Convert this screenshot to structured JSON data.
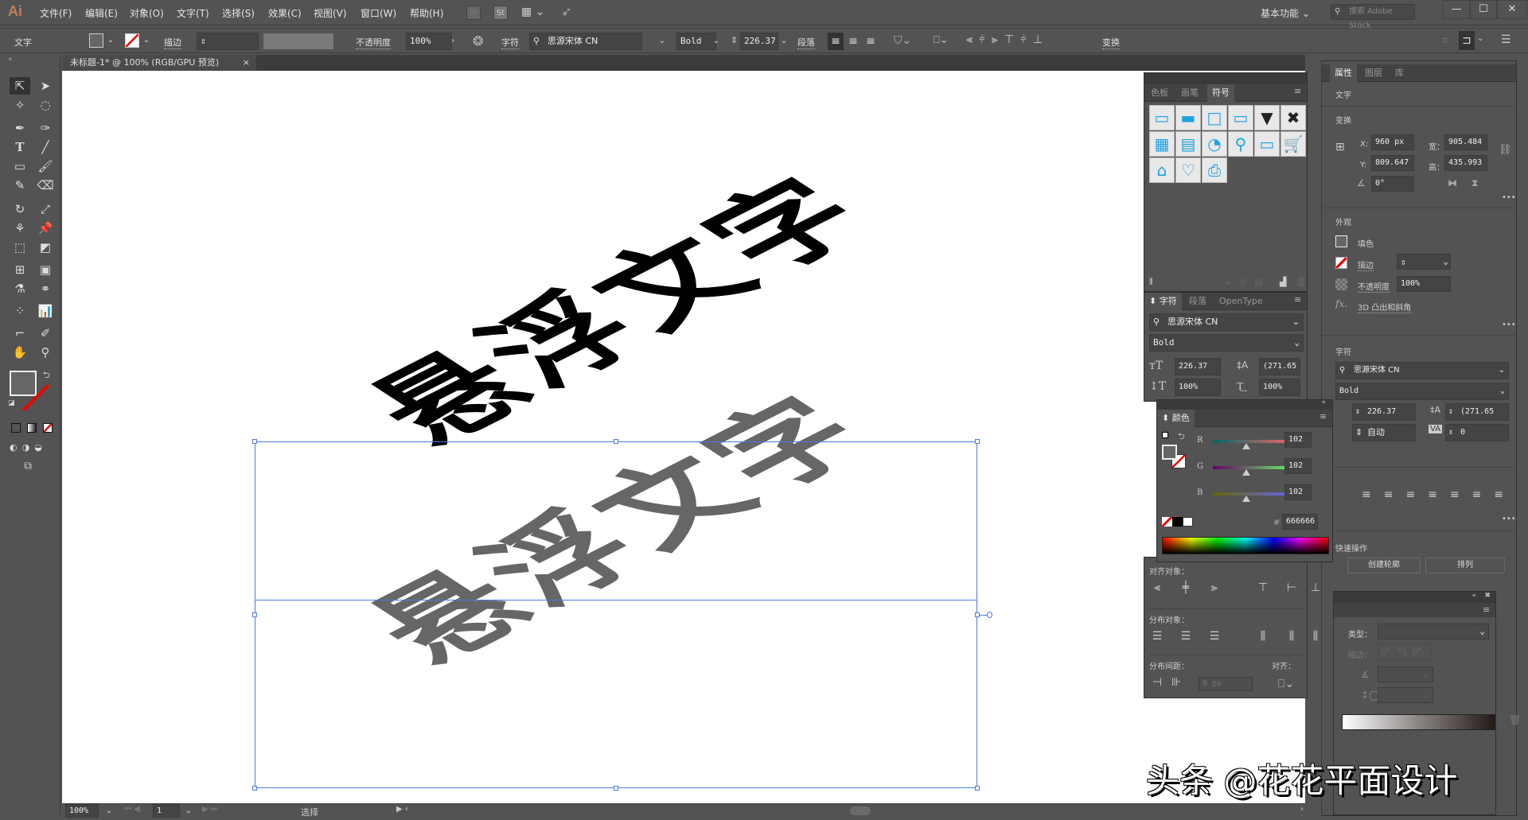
{
  "app": {
    "logo": "Ai",
    "menu": [
      "文件(F)",
      "编辑(E)",
      "对象(O)",
      "文字(T)",
      "选择(S)",
      "效果(C)",
      "视图(V)",
      "窗口(W)",
      "帮助(H)"
    ],
    "bridge_icons": [
      "Br",
      "St"
    ],
    "workspace": "基本功能",
    "search_placeholder": "搜索 Adobe Stock",
    "window_controls": {
      "minimize": "—",
      "maximize": "☐",
      "close": "✕"
    }
  },
  "control_bar": {
    "context_label": "文字",
    "stroke_label": "描边",
    "opacity_label": "不透明度",
    "opacity_value": "100%",
    "char_label": "字符",
    "font_family": "思源宋体 CN",
    "font_style": "Bold",
    "font_size": "226.37",
    "para_label": "段落",
    "transform_label": "变换"
  },
  "document": {
    "tab_title": "未标题-1* @ 100% (RGB/GPU 预览)",
    "close_icon": "×"
  },
  "canvas": {
    "text_top": "悬浮文字",
    "text_shadow": "悬浮文字",
    "text_top_color": "#000000",
    "text_shadow_color": "#666666",
    "selection_color": "#4a7be0"
  },
  "status_bar": {
    "zoom": "100%",
    "artboard": "1",
    "tool_status": "选择"
  },
  "symbols_panel": {
    "tabs": [
      "色板",
      "画笔",
      "符号"
    ],
    "active_tab": "符号",
    "symbols": [
      {
        "name": "button-flat",
        "glyph": "▭"
      },
      {
        "name": "button-gradient",
        "glyph": "▬"
      },
      {
        "name": "button-blank",
        "glyph": "□"
      },
      {
        "name": "dropdown-field",
        "glyph": "▭"
      },
      {
        "name": "dropdown-arrow",
        "glyph": "▼"
      },
      {
        "name": "close-x",
        "glyph": "✖"
      },
      {
        "name": "calendar",
        "glyph": "▦"
      },
      {
        "name": "film",
        "glyph": "▤"
      },
      {
        "name": "rss",
        "glyph": "◔"
      },
      {
        "name": "magnifier",
        "glyph": "⚲"
      },
      {
        "name": "credit-card",
        "glyph": "▭"
      },
      {
        "name": "cart",
        "glyph": "🛒"
      },
      {
        "name": "home",
        "glyph": "⌂"
      },
      {
        "name": "heart-plus",
        "glyph": "♡"
      },
      {
        "name": "printer",
        "glyph": "⎙"
      }
    ]
  },
  "character_panel": {
    "tabs": [
      "字符",
      "段落",
      "OpenType"
    ],
    "active_tab": "字符",
    "font_family": "思源宋体 CN",
    "font_style": "Bold",
    "font_size": "226.37",
    "leading": "(271.65",
    "vertical_scale": "100%",
    "horizontal_scale": "100%"
  },
  "color_panel": {
    "title": "颜色",
    "r_label": "R",
    "g_label": "G",
    "b_label": "B",
    "r": "102",
    "g": "102",
    "b": "102",
    "r_fraction": 0.4,
    "g_fraction": 0.4,
    "b_fraction": 0.4,
    "hex_label": "#",
    "hex": "666666",
    "fill_color": "#666666"
  },
  "align_panel": {
    "align_objects_label": "对齐对象：",
    "distribute_objects_label": "分布对象：",
    "distribute_spacing_label": "分布间距：",
    "align_to_label": "对齐：",
    "spacing_value": "0 px"
  },
  "properties_panel": {
    "tabs": [
      "属性",
      "图层",
      "库"
    ],
    "active_tab": "属性",
    "object_type": "文字",
    "transform_label": "变换",
    "x_label": "X:",
    "x": "960 px",
    "y_label": "Y:",
    "y": "809.647",
    "w_label": "宽：",
    "w": "905.484",
    "h_label": "高：",
    "h": "435.993",
    "angle": "0°",
    "appearance_label": "外观",
    "fill_label": "填色",
    "stroke_label": "描边",
    "opacity_label": "不透明度",
    "opacity": "100%",
    "effect_label": "3D 凸出和斜角",
    "character_label": "字符",
    "font_family": "思源宋体 CN",
    "font_style": "Bold",
    "font_size": "226.37",
    "leading": "(271.65",
    "tracking_auto": "自动",
    "kerning": "0",
    "quick_actions_label": "快速操作",
    "create_outlines": "创建轮廓",
    "arrange": "排列"
  },
  "stroke_panel": {
    "type_label": "类型：",
    "stroke_label": "描边："
  },
  "watermark": "头条 @花花平面设计"
}
